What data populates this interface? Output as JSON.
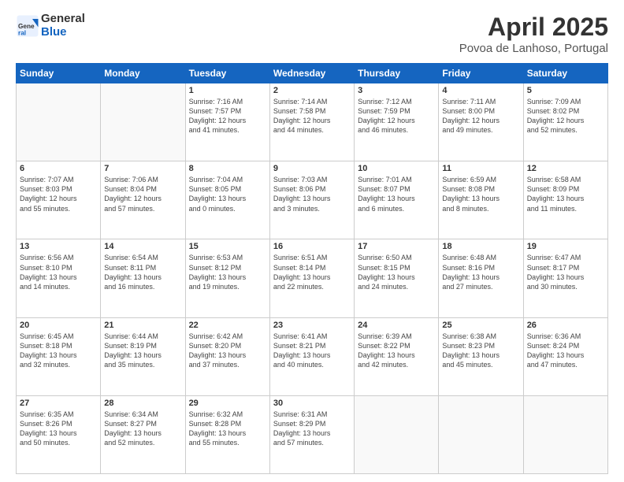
{
  "header": {
    "logo_general": "General",
    "logo_blue": "Blue",
    "month_title": "April 2025",
    "location": "Povoa de Lanhoso, Portugal"
  },
  "days_of_week": [
    "Sunday",
    "Monday",
    "Tuesday",
    "Wednesday",
    "Thursday",
    "Friday",
    "Saturday"
  ],
  "weeks": [
    [
      {
        "day": "",
        "info": ""
      },
      {
        "day": "",
        "info": ""
      },
      {
        "day": "1",
        "info": "Sunrise: 7:16 AM\nSunset: 7:57 PM\nDaylight: 12 hours\nand 41 minutes."
      },
      {
        "day": "2",
        "info": "Sunrise: 7:14 AM\nSunset: 7:58 PM\nDaylight: 12 hours\nand 44 minutes."
      },
      {
        "day": "3",
        "info": "Sunrise: 7:12 AM\nSunset: 7:59 PM\nDaylight: 12 hours\nand 46 minutes."
      },
      {
        "day": "4",
        "info": "Sunrise: 7:11 AM\nSunset: 8:00 PM\nDaylight: 12 hours\nand 49 minutes."
      },
      {
        "day": "5",
        "info": "Sunrise: 7:09 AM\nSunset: 8:02 PM\nDaylight: 12 hours\nand 52 minutes."
      }
    ],
    [
      {
        "day": "6",
        "info": "Sunrise: 7:07 AM\nSunset: 8:03 PM\nDaylight: 12 hours\nand 55 minutes."
      },
      {
        "day": "7",
        "info": "Sunrise: 7:06 AM\nSunset: 8:04 PM\nDaylight: 12 hours\nand 57 minutes."
      },
      {
        "day": "8",
        "info": "Sunrise: 7:04 AM\nSunset: 8:05 PM\nDaylight: 13 hours\nand 0 minutes."
      },
      {
        "day": "9",
        "info": "Sunrise: 7:03 AM\nSunset: 8:06 PM\nDaylight: 13 hours\nand 3 minutes."
      },
      {
        "day": "10",
        "info": "Sunrise: 7:01 AM\nSunset: 8:07 PM\nDaylight: 13 hours\nand 6 minutes."
      },
      {
        "day": "11",
        "info": "Sunrise: 6:59 AM\nSunset: 8:08 PM\nDaylight: 13 hours\nand 8 minutes."
      },
      {
        "day": "12",
        "info": "Sunrise: 6:58 AM\nSunset: 8:09 PM\nDaylight: 13 hours\nand 11 minutes."
      }
    ],
    [
      {
        "day": "13",
        "info": "Sunrise: 6:56 AM\nSunset: 8:10 PM\nDaylight: 13 hours\nand 14 minutes."
      },
      {
        "day": "14",
        "info": "Sunrise: 6:54 AM\nSunset: 8:11 PM\nDaylight: 13 hours\nand 16 minutes."
      },
      {
        "day": "15",
        "info": "Sunrise: 6:53 AM\nSunset: 8:12 PM\nDaylight: 13 hours\nand 19 minutes."
      },
      {
        "day": "16",
        "info": "Sunrise: 6:51 AM\nSunset: 8:14 PM\nDaylight: 13 hours\nand 22 minutes."
      },
      {
        "day": "17",
        "info": "Sunrise: 6:50 AM\nSunset: 8:15 PM\nDaylight: 13 hours\nand 24 minutes."
      },
      {
        "day": "18",
        "info": "Sunrise: 6:48 AM\nSunset: 8:16 PM\nDaylight: 13 hours\nand 27 minutes."
      },
      {
        "day": "19",
        "info": "Sunrise: 6:47 AM\nSunset: 8:17 PM\nDaylight: 13 hours\nand 30 minutes."
      }
    ],
    [
      {
        "day": "20",
        "info": "Sunrise: 6:45 AM\nSunset: 8:18 PM\nDaylight: 13 hours\nand 32 minutes."
      },
      {
        "day": "21",
        "info": "Sunrise: 6:44 AM\nSunset: 8:19 PM\nDaylight: 13 hours\nand 35 minutes."
      },
      {
        "day": "22",
        "info": "Sunrise: 6:42 AM\nSunset: 8:20 PM\nDaylight: 13 hours\nand 37 minutes."
      },
      {
        "day": "23",
        "info": "Sunrise: 6:41 AM\nSunset: 8:21 PM\nDaylight: 13 hours\nand 40 minutes."
      },
      {
        "day": "24",
        "info": "Sunrise: 6:39 AM\nSunset: 8:22 PM\nDaylight: 13 hours\nand 42 minutes."
      },
      {
        "day": "25",
        "info": "Sunrise: 6:38 AM\nSunset: 8:23 PM\nDaylight: 13 hours\nand 45 minutes."
      },
      {
        "day": "26",
        "info": "Sunrise: 6:36 AM\nSunset: 8:24 PM\nDaylight: 13 hours\nand 47 minutes."
      }
    ],
    [
      {
        "day": "27",
        "info": "Sunrise: 6:35 AM\nSunset: 8:26 PM\nDaylight: 13 hours\nand 50 minutes."
      },
      {
        "day": "28",
        "info": "Sunrise: 6:34 AM\nSunset: 8:27 PM\nDaylight: 13 hours\nand 52 minutes."
      },
      {
        "day": "29",
        "info": "Sunrise: 6:32 AM\nSunset: 8:28 PM\nDaylight: 13 hours\nand 55 minutes."
      },
      {
        "day": "30",
        "info": "Sunrise: 6:31 AM\nSunset: 8:29 PM\nDaylight: 13 hours\nand 57 minutes."
      },
      {
        "day": "",
        "info": ""
      },
      {
        "day": "",
        "info": ""
      },
      {
        "day": "",
        "info": ""
      }
    ]
  ]
}
